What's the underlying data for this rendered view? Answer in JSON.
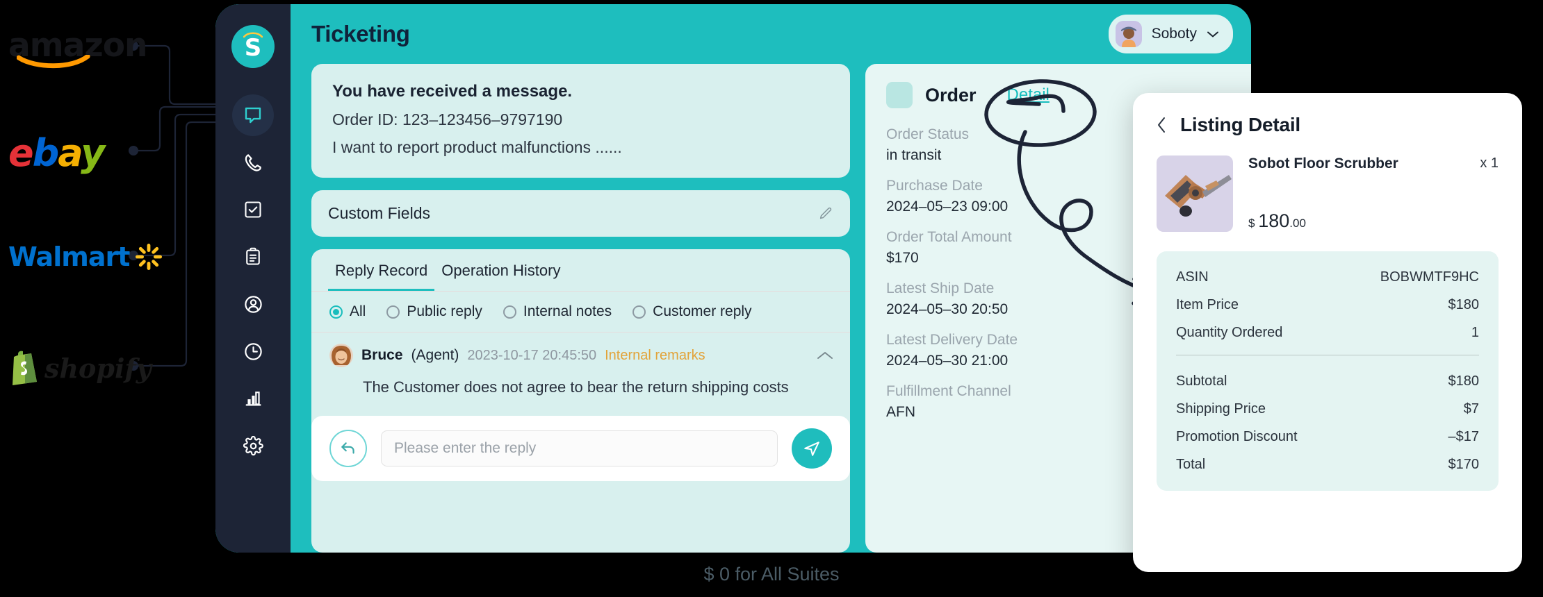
{
  "marketplaces": [
    {
      "name": "amazon",
      "label": "amazon"
    },
    {
      "name": "ebay",
      "label": "ebay",
      "letters": [
        "e",
        "b",
        "a",
        "y"
      ]
    },
    {
      "name": "walmart",
      "label": "Walmart"
    },
    {
      "name": "shopify",
      "label": "shopify"
    }
  ],
  "sidebar": {
    "logo_letter": "S",
    "items": [
      {
        "name": "chat-icon",
        "active": true
      },
      {
        "name": "phone-icon",
        "active": false
      },
      {
        "name": "task-check-icon",
        "active": false
      },
      {
        "name": "clipboard-icon",
        "active": false
      },
      {
        "name": "user-circle-icon",
        "active": false
      },
      {
        "name": "clock-icon",
        "active": false
      },
      {
        "name": "bar-chart-icon",
        "active": false
      },
      {
        "name": "gear-icon",
        "active": false
      }
    ]
  },
  "topbar": {
    "title": "Ticketing",
    "user": "Soboty"
  },
  "message": {
    "line1": "You have received a message.",
    "line2": "Order ID: 123–123456–9797190",
    "line3": "I want to report product malfunctions ......"
  },
  "custom_fields": {
    "title": "Custom Fields"
  },
  "reply_panel": {
    "tabs": [
      {
        "label": "Reply Record",
        "active": true
      },
      {
        "label": "Operation History",
        "active": false
      }
    ],
    "filters": [
      {
        "label": "All",
        "selected": true
      },
      {
        "label": "Public reply",
        "selected": false
      },
      {
        "label": "Internal notes",
        "selected": false
      },
      {
        "label": "Customer reply",
        "selected": false
      }
    ],
    "entry": {
      "author": "Bruce",
      "role": "(Agent)",
      "timestamp": "2023-10-17 20:45:50",
      "tag": "Internal remarks",
      "body": "The Customer does not agree to bear the return shipping costs"
    },
    "composer": {
      "placeholder": "Please enter the reply",
      "value": ""
    }
  },
  "order": {
    "title": "Order",
    "detail_link": "Detail",
    "fields": [
      {
        "label": "Order Status",
        "value": "in transit"
      },
      {
        "label": "Purchase Date",
        "value": "2024–05–23 09:00"
      },
      {
        "label": "Order Total Amount",
        "value": "$170"
      },
      {
        "label": "Latest Ship Date",
        "value": "2024–05–30 20:50"
      },
      {
        "label": "Latest Delivery Date",
        "value": "2024–05–30 21:00"
      },
      {
        "label": "Fulfillment Channel",
        "value": "AFN"
      }
    ]
  },
  "listing_detail": {
    "title": "Listing Detail",
    "product": {
      "name": "Sobot Floor Scrubber",
      "quantity_label": "x 1",
      "currency": "$",
      "price_main": "180",
      "price_cents": ".00"
    },
    "attributes": [
      {
        "label": "ASIN",
        "value": "BOBWMTF9HC"
      },
      {
        "label": "Item Price",
        "value": "$180"
      },
      {
        "label": "Quantity Ordered",
        "value": "1"
      }
    ],
    "totals": [
      {
        "label": "Subtotal",
        "value": "$180"
      },
      {
        "label": "Shipping Price",
        "value": "$7"
      },
      {
        "label": "Promotion Discount",
        "value": "–$17"
      },
      {
        "label": "Total",
        "value": "$170"
      }
    ]
  },
  "footer": {
    "text": "$ 0 for All Suites"
  },
  "colors": {
    "brand_teal": "#1ebebe",
    "sidebar_dark": "#1d2436",
    "card_mint": "#d8f0ee",
    "link_teal": "#17bdbd",
    "tag_amber": "#e2a33a"
  }
}
